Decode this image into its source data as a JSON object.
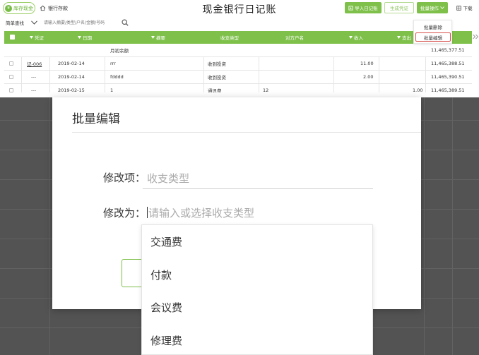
{
  "header": {
    "tabs": [
      {
        "label": "库存现金",
        "icon": "cash-icon"
      },
      {
        "label": "银行存款",
        "icon": "house-icon"
      }
    ],
    "title": "现金银行日记账",
    "buttons": {
      "import": "导入日记账",
      "voucher": "生成凭证",
      "batch": "批量操作",
      "download": "下载"
    }
  },
  "search": {
    "mode_label": "简单查找",
    "placeholder": "请输入摘要/类型/户名/金额/号码"
  },
  "batch_menu": {
    "items": [
      "批量删除",
      "批量编辑"
    ]
  },
  "table": {
    "columns": [
      "凭证",
      "日期",
      "摘要",
      "收支类型",
      "对方户名",
      "收入",
      "支出"
    ],
    "opening_row": {
      "label": "月初余额",
      "balance": "11,465,377.51"
    },
    "rows": [
      {
        "voucher": "记-006",
        "date": "2019-02-14",
        "summary": "rrr",
        "type": "收到投资",
        "counterparty": "",
        "income": "11.00",
        "expense": "",
        "balance": "11,465,388.51"
      },
      {
        "voucher": "---",
        "date": "2019-02-14",
        "summary": "fdddd",
        "type": "收到投资",
        "counterparty": "",
        "income": "2.00",
        "expense": "",
        "balance": "11,465,390.51"
      },
      {
        "voucher": "---",
        "date": "2019-02-15",
        "summary": "1",
        "type": "通讯费",
        "counterparty": "12",
        "income": "",
        "expense": "1.00",
        "balance": "11,465,389.51"
      }
    ]
  },
  "modal": {
    "title": "批量编辑",
    "field_label": "修改项：",
    "field_value": "收支类型",
    "target_label": "修改为：",
    "target_placeholder": "请输入或选择收支类型"
  },
  "options": [
    "交通费",
    "付款",
    "会议费",
    "修理费"
  ],
  "colors": {
    "accent": "#7ec04a",
    "overlay": "#535353",
    "highlight": "#d9534f"
  }
}
